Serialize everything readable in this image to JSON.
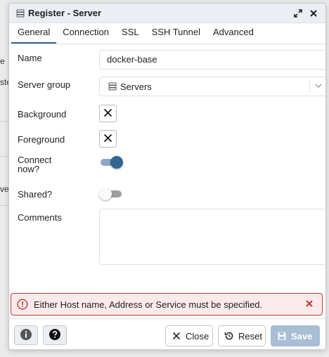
{
  "background": {
    "fragments": [
      "e",
      "ste",
      "ver"
    ]
  },
  "dialog": {
    "title": "Register - Server",
    "title_icon": "server-icon",
    "controls": {
      "maximize_icon": "expand-icon",
      "close_icon": "close-icon"
    }
  },
  "tabs": [
    {
      "label": "General",
      "active": true
    },
    {
      "label": "Connection",
      "active": false
    },
    {
      "label": "SSL",
      "active": false
    },
    {
      "label": "SSH Tunnel",
      "active": false
    },
    {
      "label": "Advanced",
      "active": false
    }
  ],
  "form": {
    "name": {
      "label": "Name",
      "value": "docker-base"
    },
    "server_group": {
      "label": "Server group",
      "value": "Servers",
      "icon": "server-group-icon",
      "dropdown_icon": "chevron-down-icon"
    },
    "background": {
      "label": "Background",
      "icon": "x-mark-icon"
    },
    "foreground": {
      "label": "Foreground",
      "icon": "x-mark-icon"
    },
    "connect_now": {
      "label_line1": "Connect",
      "label_line2": "now?",
      "checked": true
    },
    "shared": {
      "label": "Shared?",
      "checked": false
    },
    "comments": {
      "label": "Comments",
      "value": ""
    }
  },
  "alert": {
    "message": "Either Host name, Address or Service must be specified.",
    "icon": "error-circle-icon",
    "close_icon": "close-icon",
    "color": "#c0392b"
  },
  "footer": {
    "info_icon": "info-icon",
    "help_icon": "help-icon",
    "close_label": "Close",
    "reset_label": "Reset",
    "save_label": "Save"
  },
  "colors": {
    "accent": "#326690",
    "save_disabled": "#a7bed4",
    "alert_bg": "#fbeaec",
    "alert_border": "#c0392b"
  }
}
